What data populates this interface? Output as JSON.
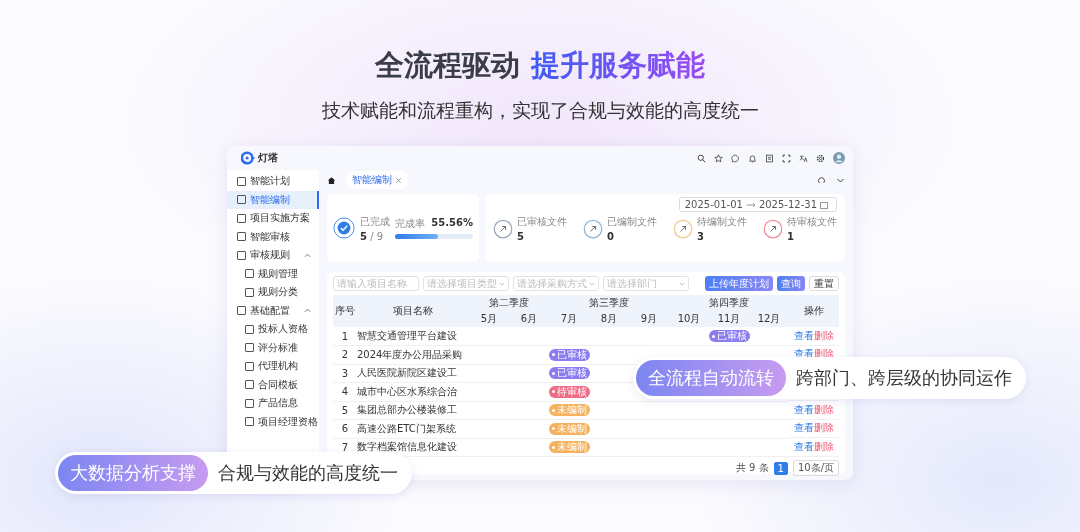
{
  "headline": {
    "lead": "全流程驱动",
    "accent": "提升服务赋能"
  },
  "subtitle": "技术赋能和流程重构，实现了合规与效能的高度统一",
  "app": {
    "brand": "灯塔",
    "sidebar": [
      {
        "label": "智能计划",
        "selected": false
      },
      {
        "label": "智能编制",
        "selected": true
      },
      {
        "label": "项目实施方案",
        "selected": false
      },
      {
        "label": "智能审核",
        "selected": false
      },
      {
        "label": "审核规则",
        "selected": false,
        "expanded": true,
        "children": [
          {
            "label": "规则管理",
            "selected": false
          },
          {
            "label": "规则分类",
            "selected": false
          }
        ]
      },
      {
        "label": "基础配置",
        "selected": false,
        "expanded": true,
        "children": [
          {
            "label": "投标人资格",
            "selected": false
          },
          {
            "label": "评分标准",
            "selected": false
          },
          {
            "label": "代理机构",
            "selected": false
          },
          {
            "label": "合同模板",
            "selected": false
          },
          {
            "label": "产品信息",
            "selected": false
          },
          {
            "label": "项目经理资格",
            "selected": false
          }
        ]
      }
    ],
    "tabs": [
      {
        "label": "智能编制",
        "selected": true
      }
    ],
    "summary": {
      "label": "已完成",
      "done": "5",
      "total": "/ 9",
      "rate_label": "完成率",
      "rate": "55.56%",
      "level": 0.5556
    },
    "stats": [
      {
        "label": "已审核文件",
        "value": "5",
        "color": "#9aa6b8"
      },
      {
        "label": "已编制文件",
        "value": "0",
        "color": "#8fb8d8"
      },
      {
        "label": "待编制文件",
        "value": "3",
        "color": "#f0c890"
      },
      {
        "label": "待审核文件",
        "value": "1",
        "color": "#f08a9a"
      }
    ],
    "date_range": {
      "start": "2025-01-01",
      "end": "2025-12-31"
    },
    "filters": [
      {
        "placeholder": "请输入项目名称",
        "kind": "input"
      },
      {
        "placeholder": "请选择项目类型",
        "kind": "select"
      },
      {
        "placeholder": "请选择采购方式",
        "kind": "select"
      },
      {
        "placeholder": "请选择部门",
        "kind": "select"
      }
    ],
    "buttons": [
      {
        "label": "上传年度计划",
        "kind": "primary"
      },
      {
        "label": "查询",
        "kind": "primary"
      },
      {
        "label": "重置",
        "kind": "plain"
      }
    ],
    "table": {
      "index_header": "序号",
      "name_header": "项目名称",
      "action_header": "操作",
      "quarters": [
        {
          "label": "第二季度",
          "months": [
            "5月",
            "6月"
          ]
        },
        {
          "label": "第三季度",
          "months": [
            "7月",
            "8月",
            "9月"
          ]
        },
        {
          "label": "第四季度",
          "months": [
            "10月",
            "11月",
            "12月"
          ]
        }
      ],
      "rows": [
        {
          "index": "1",
          "name": "智慧交通管理平台建设",
          "cells": [
            null,
            null,
            null,
            null,
            null,
            null,
            {
              "label": "已审核",
              "kind": "approved"
            },
            null
          ],
          "actions": [
            "查看",
            "删除"
          ]
        },
        {
          "index": "2",
          "name": "2024年度办公用品采购",
          "cells": [
            null,
            null,
            {
              "label": "已审核",
              "kind": "approved"
            },
            null,
            null,
            null,
            null,
            null
          ],
          "actions": [
            "查看",
            "删除"
          ]
        },
        {
          "index": "3",
          "name": "人民医院新院区建设工",
          "cells": [
            null,
            null,
            {
              "label": "已审核",
              "kind": "approved"
            },
            null,
            null,
            null,
            null,
            null
          ]
        },
        {
          "index": "4",
          "name": "城市中心区水系综合治",
          "cells": [
            null,
            null,
            {
              "label": "待审核",
              "kind": "pending"
            },
            null,
            null,
            null,
            null,
            null
          ]
        },
        {
          "index": "5",
          "name": "集团总部办公楼装修工",
          "cells": [
            null,
            null,
            {
              "label": "未编制",
              "kind": "draft"
            },
            null,
            null,
            null,
            null,
            null
          ],
          "actions": [
            "查看",
            "删除"
          ]
        },
        {
          "index": "6",
          "name": "高速公路ETC门架系统",
          "cells": [
            null,
            null,
            {
              "label": "未编制",
              "kind": "draft"
            },
            null,
            null,
            null,
            null,
            null
          ],
          "actions": [
            "查看",
            "删除"
          ]
        },
        {
          "index": "7",
          "name": "数字档案馆信息化建设",
          "cells": [
            null,
            null,
            {
              "label": "未编制",
              "kind": "draft"
            },
            null,
            null,
            null,
            null,
            null
          ],
          "actions": [
            "查看",
            "删除"
          ]
        }
      ]
    },
    "pagination": {
      "total": "共 9 条",
      "pages": [
        {
          "label": "1",
          "selected": true
        }
      ],
      "page_size": "10条/页"
    }
  },
  "callouts": [
    {
      "tag": "全流程自动流转",
      "text": "跨部门、跨层级的协同运作"
    },
    {
      "tag": "大数据分析支撑",
      "text": "合规与效能的高度统一"
    }
  ]
}
